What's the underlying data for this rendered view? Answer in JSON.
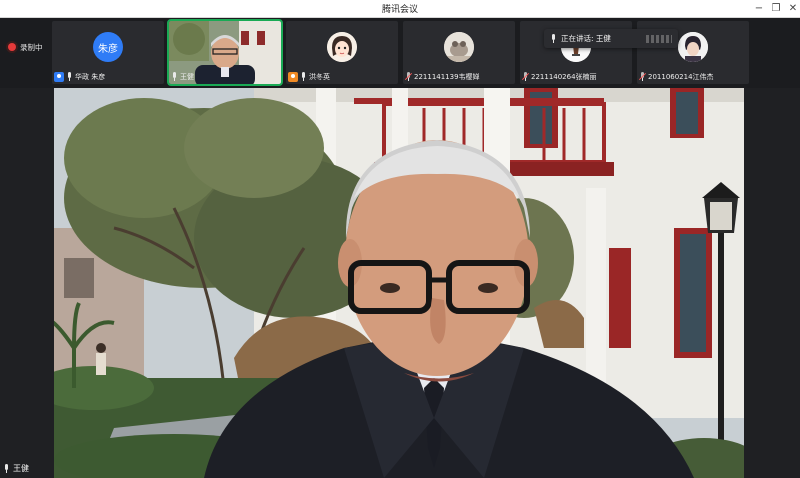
{
  "window": {
    "title": "腾讯会议",
    "controls": {
      "minimize": "−",
      "maximize": "❐",
      "close": "✕"
    }
  },
  "recording": {
    "label": "录制中"
  },
  "participants": [
    {
      "name": "华政 朱彦",
      "avatar_text": "朱彦",
      "avatar_color": "#2f7cf6",
      "host": true,
      "mic": "on"
    },
    {
      "name": "王健",
      "mic": "on",
      "video": true,
      "active": true
    },
    {
      "name": "洪冬英",
      "host": true,
      "host_color": "#f08a24",
      "mic": "on",
      "avatar_type": "cartoon"
    },
    {
      "name": "2211141139韦樱婵",
      "mic": "muted",
      "avatar_type": "photo"
    },
    {
      "name": "2211140264张楠丽",
      "mic": "muted",
      "avatar_type": "emblem"
    },
    {
      "name": "2011060214江伟杰",
      "mic": "muted",
      "avatar_type": "photo"
    }
  ],
  "speaking_now": {
    "label": "正在讲话: 王健"
  },
  "main_video": {
    "speaker_name": "王健"
  },
  "colors": {
    "accent": "#2f7cf6",
    "active_outline": "#1aaa55",
    "record": "#e63a3a"
  }
}
